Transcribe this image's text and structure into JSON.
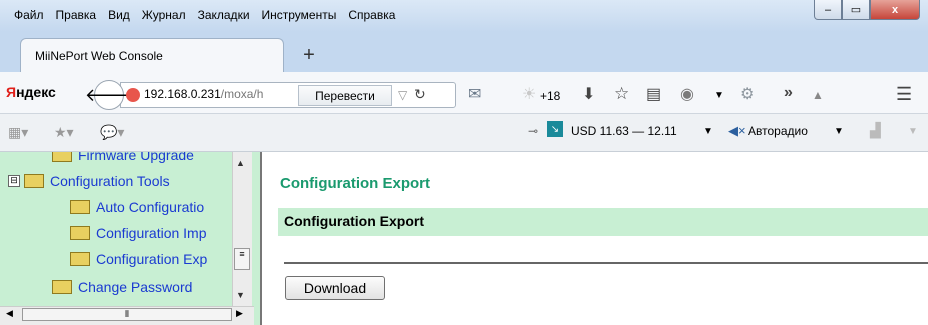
{
  "menu": [
    "Файл",
    "Правка",
    "Вид",
    "Журнал",
    "Закладки",
    "Инструменты",
    "Справка"
  ],
  "window_controls": {
    "minimize": "–",
    "maximize": "▭",
    "close": "x"
  },
  "tab": {
    "title": "MiiNePort Web Console",
    "new_tab": "+"
  },
  "nav": {
    "yandex_prefix": "Я",
    "yandex_rest": "ндекс",
    "url_host": "192.168.0.231",
    "url_path": "/moxa/h",
    "translate": "Перевести",
    "weather": "+18"
  },
  "bookmarks": {
    "usd": "USD 11.63 — 12.11",
    "radio": "Авторадио"
  },
  "tree": [
    {
      "label": "Firmware Upgrade"
    },
    {
      "label": "Configuration Tools",
      "expander": "⊟"
    },
    {
      "label": "Auto Configuratio"
    },
    {
      "label": "Configuration Imp"
    },
    {
      "label": "Configuration Exp"
    },
    {
      "label": "Change Password"
    }
  ],
  "content": {
    "page_title": "Configuration Export",
    "section_title": "Configuration Export",
    "download_button": "Download"
  },
  "colors": {
    "accent_green": "#1a9a6e",
    "panel_green": "#c8efd3",
    "link_blue": "#1a3ad1"
  }
}
